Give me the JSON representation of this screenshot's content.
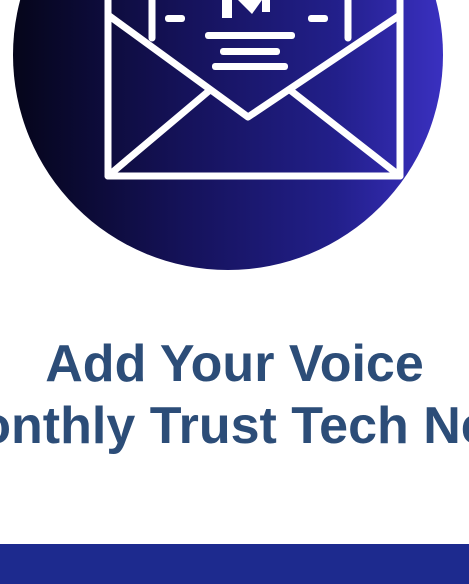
{
  "hero": {
    "icon": "mail-envelope-icon",
    "colors": {
      "gradient_start": "#05051a",
      "gradient_end": "#3a30c0",
      "icon_stroke": "#ffffff"
    }
  },
  "headline": {
    "line1": "Add Your Voice",
    "line2": "onthly Trust Tech Ne",
    "color": "#2c4d78"
  },
  "footer_bar": {
    "color": "#1d2a8e"
  }
}
